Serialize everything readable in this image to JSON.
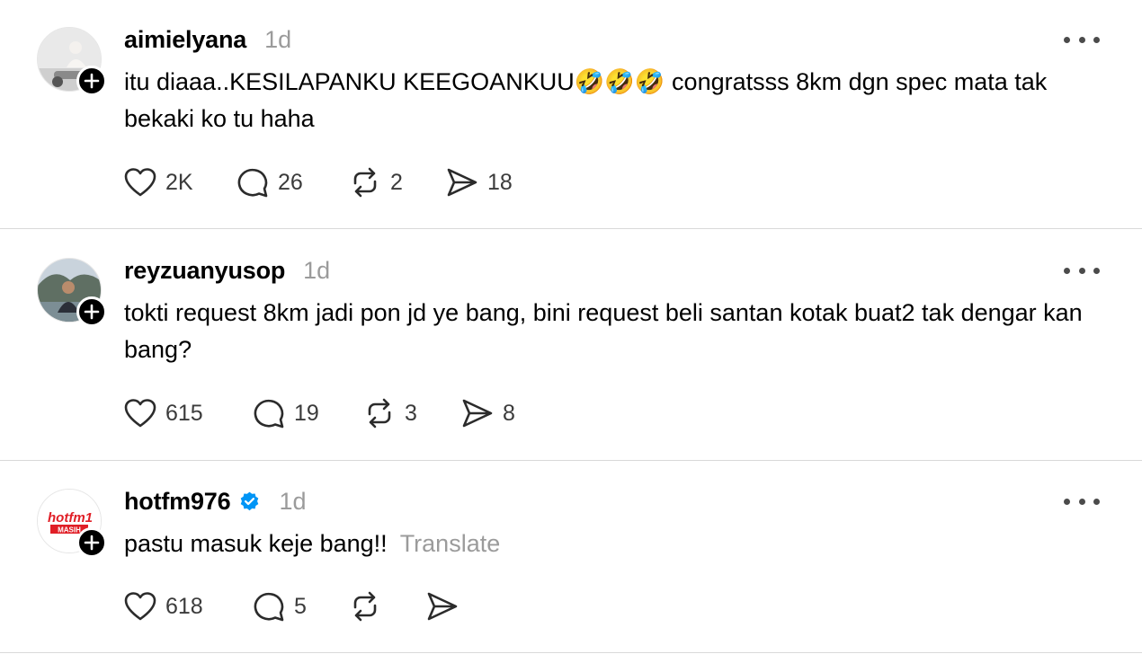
{
  "posts": [
    {
      "username": "aimielyana",
      "verified": false,
      "time": "1d",
      "text": "itu diaaa..KESILAPANKU KEEGOANKUU🤣🤣🤣 congratsss 8km dgn spec mata tak bekaki ko tu haha",
      "translate": "",
      "likes": "2K",
      "replies": "26",
      "reposts": "2",
      "shares": "18"
    },
    {
      "username": "reyzuanyusop",
      "verified": false,
      "time": "1d",
      "text": "tokti request 8km jadi pon jd ye bang, bini request beli santan kotak buat2 tak dengar kan bang?",
      "translate": "",
      "likes": "615",
      "replies": "19",
      "reposts": "3",
      "shares": "8"
    },
    {
      "username": "hotfm976",
      "verified": true,
      "time": "1d",
      "text": "pastu masuk keje bang!!",
      "translate": "Translate",
      "likes": "618",
      "replies": "5",
      "reposts": "",
      "shares": ""
    }
  ],
  "avatar_logo": {
    "line1": "hotfm1",
    "line2": "MASIH"
  },
  "colors": {
    "verified": "#0095f6",
    "muted": "#9b9b9b",
    "badge": "#000000"
  }
}
